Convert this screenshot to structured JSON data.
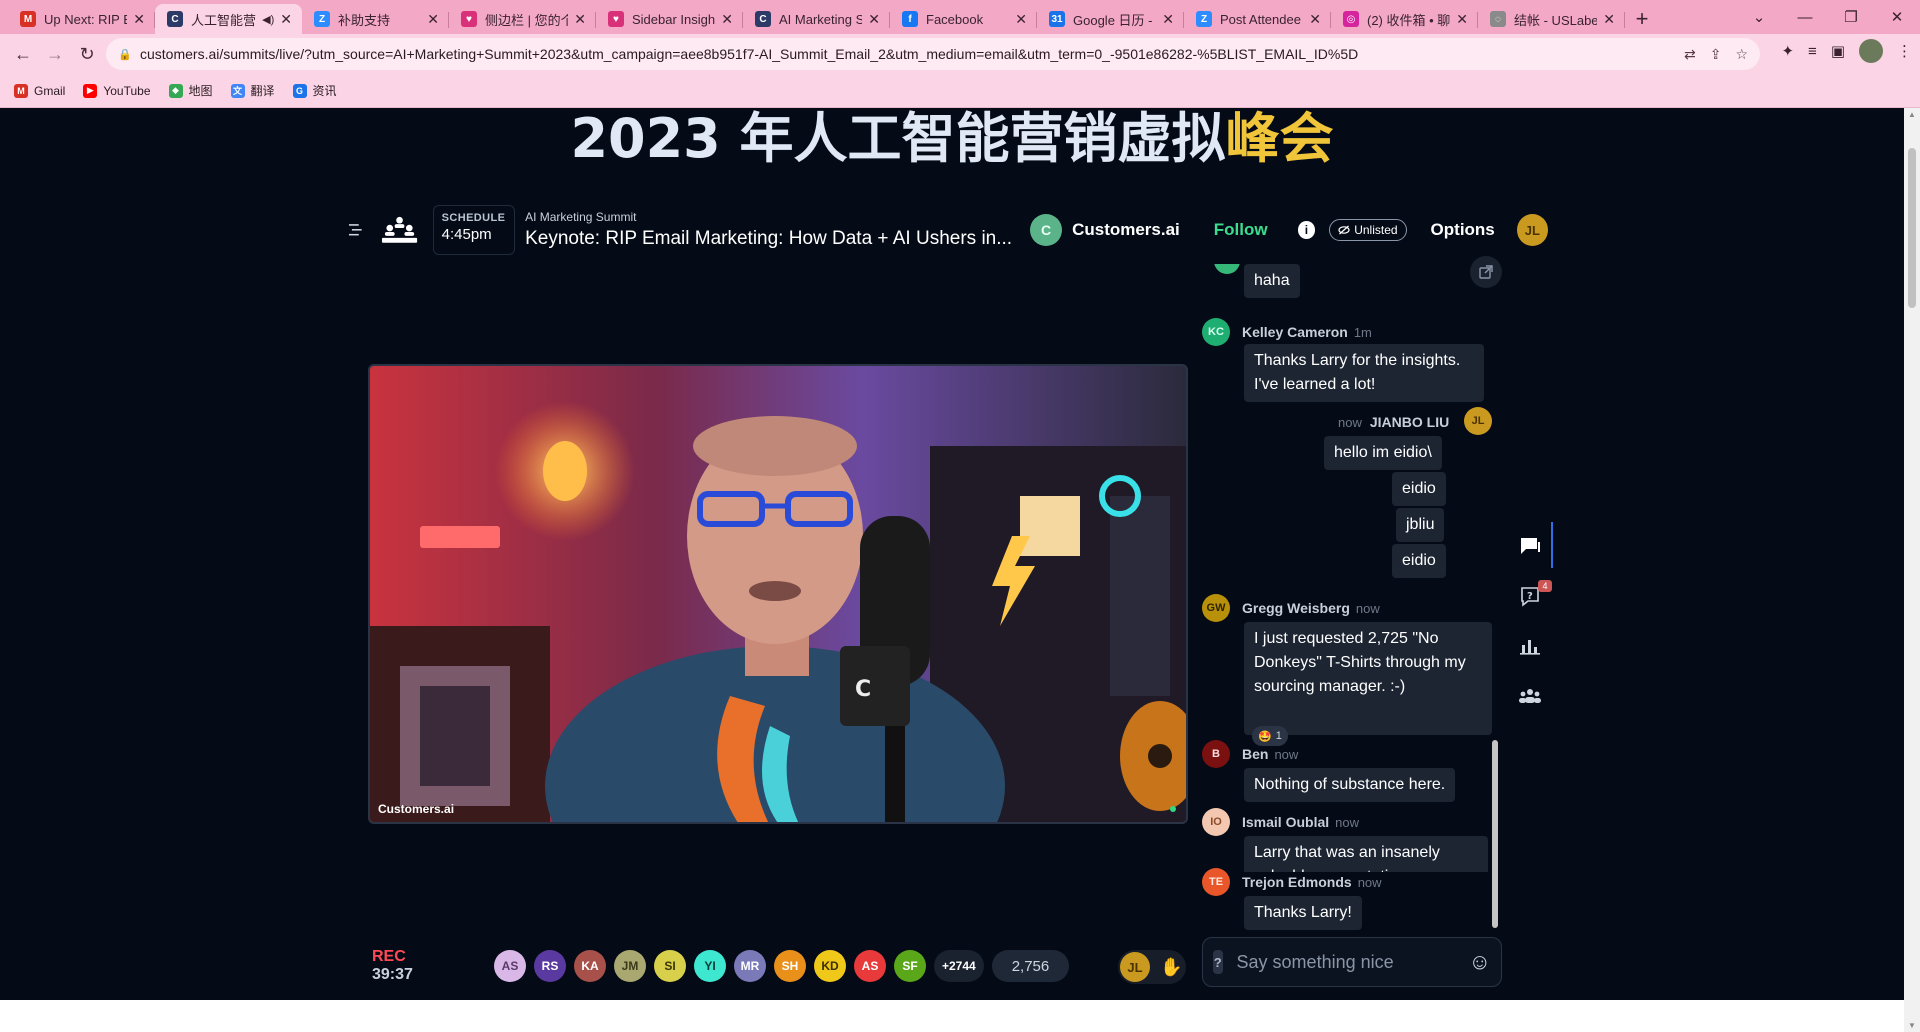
{
  "browser": {
    "tabs": [
      {
        "label": "Up Next: RIP E",
        "icon": "gmail-icon",
        "color": "#d93025",
        "glyph": "M"
      },
      {
        "label": "人工智能营",
        "icon": "customers-ai-icon",
        "color": "#2b3a67",
        "glyph": "C",
        "active": true
      },
      {
        "label": "补助支持",
        "icon": "zoom-icon",
        "color": "#2d8cff",
        "glyph": "Z"
      },
      {
        "label": "侧边栏 | 您的个",
        "icon": "heart-icon",
        "color": "#d9307a",
        "glyph": "♥"
      },
      {
        "label": "Sidebar Insigh",
        "icon": "heart-icon",
        "color": "#d9307a",
        "glyph": "♥"
      },
      {
        "label": "AI Marketing S",
        "icon": "customers-ai-icon",
        "color": "#2b3a67",
        "glyph": "C"
      },
      {
        "label": "Facebook",
        "icon": "facebook-icon",
        "color": "#1877f2",
        "glyph": "f"
      },
      {
        "label": "Google 日历 - ",
        "icon": "calendar-icon",
        "color": "#1a73e8",
        "glyph": "31"
      },
      {
        "label": "Post Attendee",
        "icon": "zoom-icon",
        "color": "#2d8cff",
        "glyph": "Z"
      },
      {
        "label": "(2) 收件箱 • 聊",
        "icon": "instagram-icon",
        "color": "#d6249f",
        "glyph": "◎"
      },
      {
        "label": "结帐 - USLabel",
        "icon": "globe-icon",
        "color": "#8a8a8a",
        "glyph": "◌"
      }
    ],
    "new_tab": "+",
    "url": "customers.ai/summits/live/?utm_source=AI+Marketing+Summit+2023&utm_campaign=aee8b951f7-AI_Summit_Email_2&utm_medium=email&utm_term=0_-9501e86282-%5BLIST_EMAIL_ID%5D",
    "bookmarks": [
      {
        "label": "Gmail",
        "icon": "gmail-icon",
        "color": "#d93025",
        "glyph": "M"
      },
      {
        "label": "YouTube",
        "icon": "youtube-icon",
        "color": "#ff0000",
        "glyph": "▶"
      },
      {
        "label": "地图",
        "icon": "maps-icon",
        "color": "#34a853",
        "glyph": "◆"
      },
      {
        "label": "翻译",
        "icon": "translate-icon",
        "color": "#4285f4",
        "glyph": "文"
      },
      {
        "label": "资讯",
        "icon": "news-icon",
        "color": "#1a73e8",
        "glyph": "G"
      }
    ]
  },
  "page": {
    "title_main": "2023 年人工智能营销虚拟",
    "title_highlight": "峰会",
    "session": {
      "schedule_label": "SCHEDULE",
      "schedule_time": "4:45pm",
      "summit_name": "AI Marketing Summit",
      "title": "Keynote: RIP Email Marketing: How Data + AI Ushers in...",
      "host_initial": "C",
      "host_name": "Customers.ai",
      "follow_label": "Follow",
      "info": "i",
      "unlisted_label": "Unlisted",
      "options_label": "Options",
      "me_initials": "JL"
    },
    "video": {
      "brand_label": "Customers.ai"
    },
    "chat": {
      "messages": [
        {
          "bubble": "haha"
        },
        {
          "initials": "KC",
          "name": "Kelley Cameron",
          "time": "1m",
          "bubble": "Thanks Larry for the insights. I've learned a lot!"
        },
        {
          "initials": "JL",
          "name": "JIANBO LIU",
          "time": "now",
          "bubbles": [
            "hello im eidio\\",
            "eidio",
            "jbliu",
            "eidio"
          ]
        },
        {
          "initials": "GW",
          "name": "Gregg Weisberg",
          "time": "now",
          "bubble": "I just requested 2,725 \"No Donkeys\"  T-Shirts through my sourcing manager. :-)",
          "reaction_emoji": "🤩",
          "reaction_count": "1"
        },
        {
          "initials": "B",
          "name": "Ben",
          "time": "now",
          "bubble": "Nothing of substance here."
        },
        {
          "initials": "IO",
          "name": "Ismail Oublal",
          "time": "now",
          "bubble": "Larry that was an insanely valuable presentation"
        },
        {
          "initials": "TE",
          "name": "Trejon Edmonds",
          "time": "now",
          "bubble": "Thanks Larry!"
        }
      ],
      "input_placeholder": "Say something nice",
      "q_icon": "?"
    },
    "rail": {
      "questions_badge": "4"
    },
    "rec": {
      "label": "REC",
      "time": "39:37"
    },
    "attendees": [
      {
        "initials": "AS",
        "bg": "#d9b8e8",
        "fg": "#5a3a6a"
      },
      {
        "initials": "RS",
        "bg": "#5a3aa0",
        "fg": "#fff"
      },
      {
        "initials": "KA",
        "bg": "#a8504a",
        "fg": "#fff"
      },
      {
        "initials": "JM",
        "bg": "#a8a870",
        "fg": "#3a3a1a"
      },
      {
        "initials": "SI",
        "bg": "#d8d04a",
        "fg": "#3a3500"
      },
      {
        "initials": "YI",
        "bg": "#3ee8d0",
        "fg": "#0a3a34"
      },
      {
        "initials": "MR",
        "bg": "#7a7ab8",
        "fg": "#fff"
      },
      {
        "initials": "SH",
        "bg": "#e8901a",
        "fg": "#fff"
      },
      {
        "initials": "KD",
        "bg": "#f0c81a",
        "fg": "#3a3000"
      },
      {
        "initials": "AS",
        "bg": "#e83a3a",
        "fg": "#fff"
      },
      {
        "initials": "SF",
        "bg": "#5aa81a",
        "fg": "#fff"
      }
    ],
    "attendees_more": "+2744",
    "attendees_total": "2,756",
    "hand_initials": "JL"
  },
  "colors": {
    "accent_follow": "#3ddc8e",
    "rec": "#ff4a56",
    "title_highlight": "#f0c53a"
  }
}
